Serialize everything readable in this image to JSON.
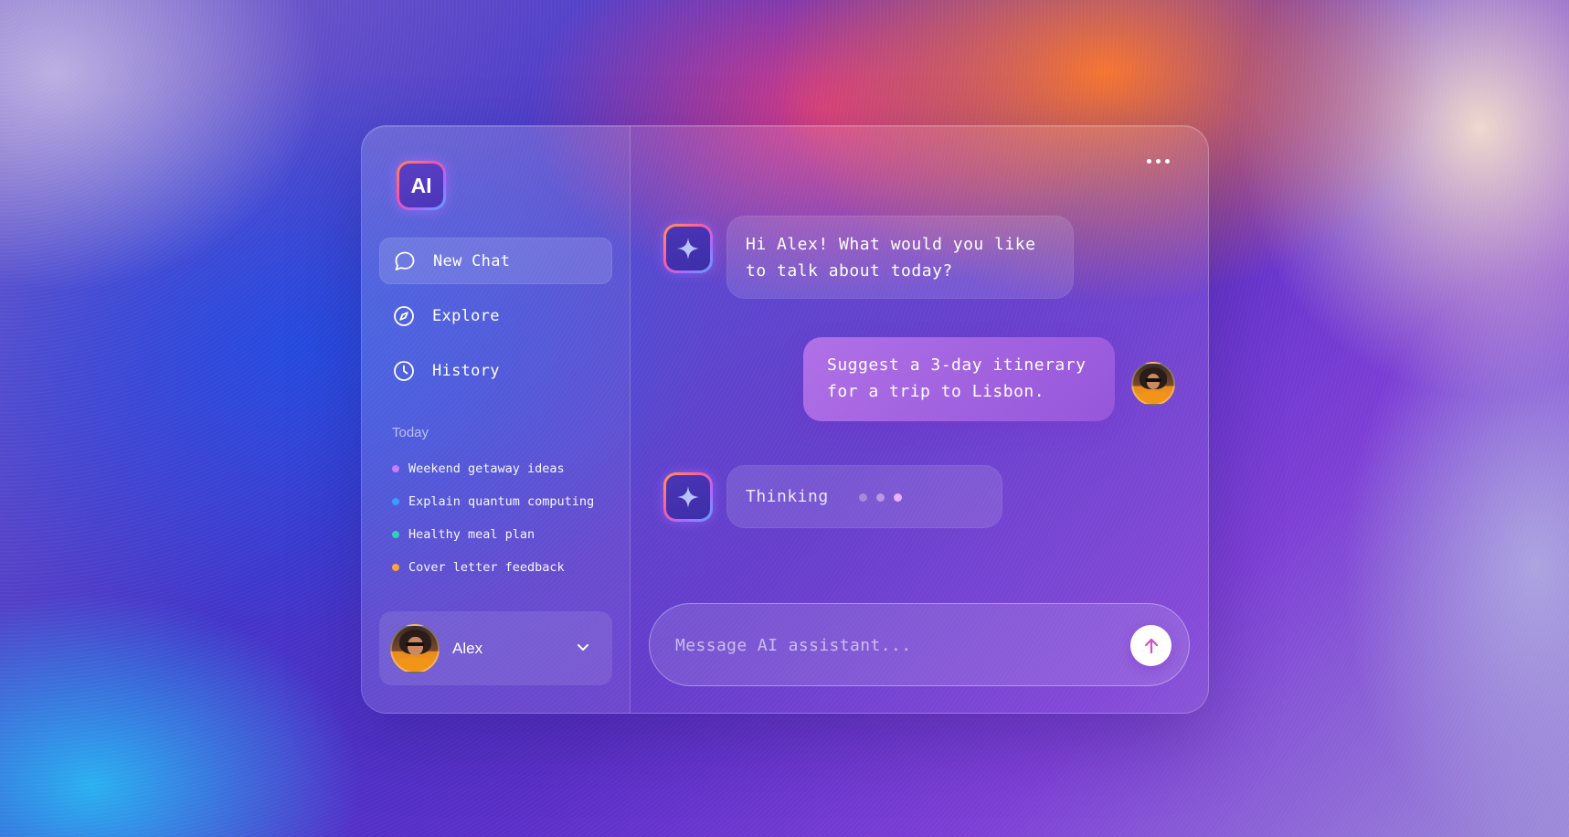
{
  "app": {
    "logo_text": "AI"
  },
  "sidebar": {
    "nav": [
      {
        "label": "New Chat",
        "icon": "chat-bubble-icon",
        "active": true
      },
      {
        "label": "Explore",
        "icon": "compass-icon",
        "active": false
      },
      {
        "label": "History",
        "icon": "clock-icon",
        "active": false
      }
    ],
    "section_title": "Today",
    "recent_chats": [
      {
        "label": "Weekend getaway ideas",
        "color": "#c77dff"
      },
      {
        "label": "Explain quantum computing",
        "color": "#3b9bff"
      },
      {
        "label": "Healthy meal plan",
        "color": "#2fd1b5"
      },
      {
        "label": "Cover letter feedback",
        "color": "#ffa23a"
      }
    ],
    "user": {
      "name": "Alex"
    }
  },
  "chat": {
    "messages": [
      {
        "role": "assistant",
        "lines": [
          "Hi Alex! What would you like",
          "to talk about today?"
        ]
      },
      {
        "role": "user",
        "lines": [
          "Suggest a 3-day itinerary",
          "for a trip to Lisbon."
        ]
      },
      {
        "role": "assistant",
        "status": "Thinking"
      }
    ],
    "thinking_dot_colors": [
      "#a58ad8",
      "#b99ae0",
      "#e9b3ff"
    ],
    "composer": {
      "placeholder": "Message AI assistant..."
    }
  },
  "colors": {
    "accent": "#c77dff",
    "send_arrow": "#d44dc7"
  }
}
